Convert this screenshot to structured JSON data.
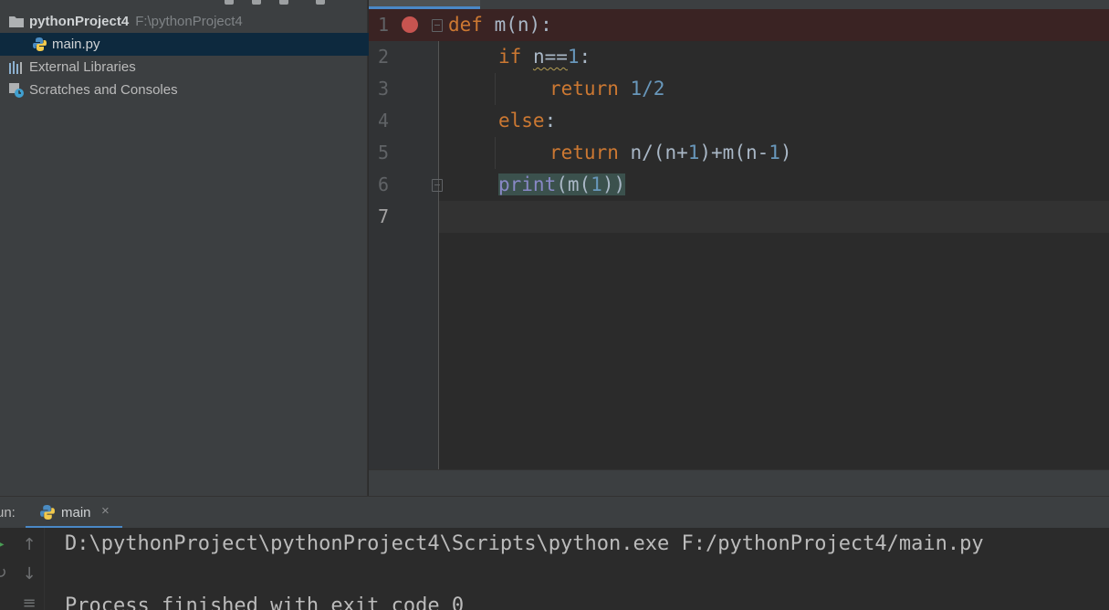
{
  "project_tree": {
    "root_name": "pythonProject4",
    "root_path": "F:\\pythonProject4",
    "selected_file": "main.py",
    "items": [
      {
        "label": "External Libraries"
      },
      {
        "label": "Scratches and Consoles"
      }
    ]
  },
  "editor": {
    "line_numbers": [
      "1",
      "2",
      "3",
      "4",
      "5",
      "6",
      "7"
    ],
    "tokens": {
      "l1_def": "def",
      "l1_rest": " m(n):",
      "l2_if": "if",
      "l2_cond": "n==",
      "l2_one": "1",
      "l2_colon": ":",
      "l3_return": "return",
      "l3_val": "1/2",
      "l4_else": "else",
      "l4_colon": ":",
      "l5_return": "return",
      "l5_a": "n/(n+",
      "l5_one": "1",
      "l5_b": ")+m(n-",
      "l5_one2": "1",
      "l5_c": ")",
      "l6_print": "print",
      "l6_a": "(m(",
      "l6_one": "1",
      "l6_b": "))"
    }
  },
  "run_window": {
    "label": "un:",
    "tab_label": "main",
    "close_glyph": "×",
    "output": [
      "D:\\pythonProject\\pythonProject4\\Scripts\\python.exe F:/pythonProject4/main.py",
      "",
      "Process finished with exit code 0"
    ]
  },
  "colors": {
    "keyword": "#cc7832",
    "number": "#6897bb",
    "builtin": "#8888c6",
    "breakpoint": "#c75450",
    "selection": "#0d293e",
    "accent": "#4a88c7"
  }
}
